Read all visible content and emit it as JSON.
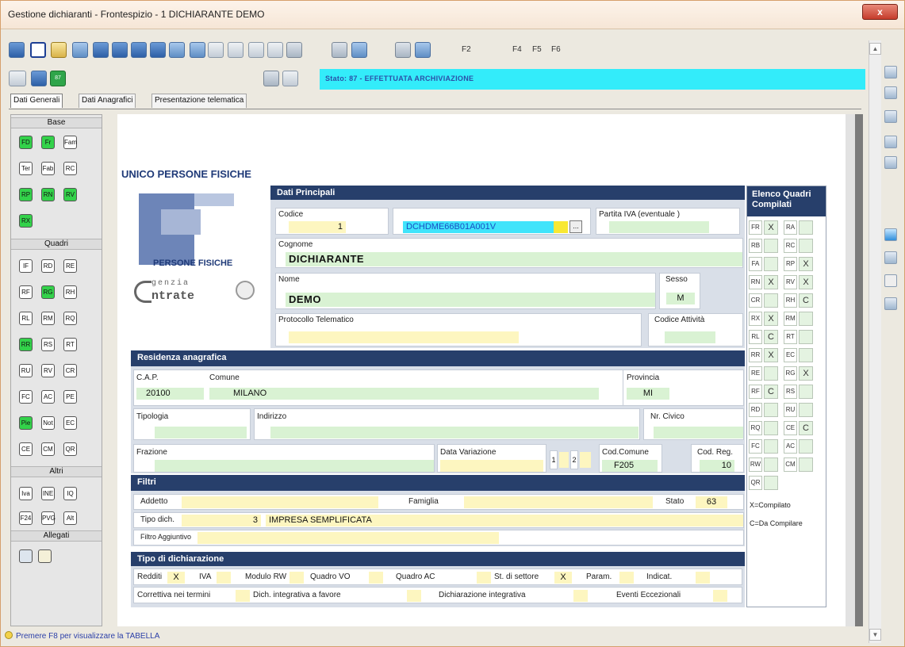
{
  "window": {
    "title": "Gestione dichiaranti - Frontespizio - 1 DICHIARANTE DEMO",
    "close_label": "x"
  },
  "toolbar": {
    "fkeys": [
      "F2",
      "F4",
      "F5",
      "F6"
    ],
    "small_badge": "87"
  },
  "status": {
    "text": "Stato: 87 - EFFETTUATA ARCHIVIAZIONE",
    "color": "#33ecfa"
  },
  "tabs": [
    "Dati Generali",
    "Dati Anagrafici",
    "Presentazione telematica"
  ],
  "left_panel": {
    "groups": [
      "Base",
      "Quadri",
      "Altri",
      "Allegati"
    ],
    "base": [
      {
        "code": "FD",
        "done": true
      },
      {
        "code": "Fr",
        "done": true
      },
      {
        "code": "Fam",
        "done": false
      },
      {
        "code": "Ter",
        "done": false
      },
      {
        "code": "Fab",
        "done": false
      },
      {
        "code": "RC",
        "done": false
      },
      {
        "code": "RP",
        "done": true
      },
      {
        "code": "RN",
        "done": true
      },
      {
        "code": "RV",
        "done": true
      },
      {
        "code": "RX",
        "done": true
      }
    ],
    "quadri": [
      {
        "code": "IF",
        "done": false
      },
      {
        "code": "RD",
        "done": false
      },
      {
        "code": "RE",
        "done": false
      },
      {
        "code": "RF",
        "done": false
      },
      {
        "code": "RG",
        "done": true
      },
      {
        "code": "RH",
        "done": false
      },
      {
        "code": "RL",
        "done": false
      },
      {
        "code": "RM",
        "done": false
      },
      {
        "code": "RQ",
        "done": false
      },
      {
        "code": "RR",
        "done": true
      },
      {
        "code": "RS",
        "done": false
      },
      {
        "code": "RT",
        "done": false
      },
      {
        "code": "RU",
        "done": false
      },
      {
        "code": "RV",
        "done": false
      },
      {
        "code": "CR",
        "done": false
      },
      {
        "code": "FC",
        "done": false
      },
      {
        "code": "AC",
        "done": false
      },
      {
        "code": "PE",
        "done": false
      },
      {
        "code": "Pie",
        "done": true
      },
      {
        "code": "Not",
        "done": false
      },
      {
        "code": "EC",
        "done": false
      },
      {
        "code": "CE",
        "done": false
      },
      {
        "code": "CM",
        "done": false
      },
      {
        "code": "QR",
        "done": false
      }
    ],
    "altri": [
      {
        "code": "Iva",
        "done": false
      },
      {
        "code": "INE",
        "done": false
      },
      {
        "code": "IQ",
        "done": false
      },
      {
        "code": "F24",
        "done": false
      },
      {
        "code": "PVG",
        "done": false
      },
      {
        "code": "Alt",
        "done": false
      }
    ]
  },
  "form": {
    "heading": "UNICO PERSONE FISICHE",
    "logo": {
      "line1": "PERSONE FISICHE",
      "line2a": "genzia",
      "line2b": "ntrate"
    },
    "dati_principali": {
      "header": "Dati Principali",
      "codice_label": "Codice",
      "codice_value": "1",
      "cf_value": "DCHDME66B01A001V",
      "cf_button": "...",
      "piva_label": "Partita IVA (eventuale )",
      "piva_value": "",
      "cognome_label": "Cognome",
      "cognome_value": "DICHIARANTE",
      "nome_label": "Nome",
      "nome_value": "DEMO",
      "sesso_label": "Sesso",
      "sesso_value": "M",
      "protocollo_label": "Protocollo Telematico",
      "protocollo_value": "",
      "codice_attivita_label": "Codice Attività",
      "codice_attivita_value": ""
    },
    "residenza": {
      "header": "Residenza anagrafica",
      "cap_label": "C.A.P.",
      "cap_value": "20100",
      "comune_label": "Comune",
      "comune_value": "MILANO",
      "provincia_label": "Provincia",
      "provincia_value": "MI",
      "tipologia_label": "Tipologia",
      "tipologia_value": "",
      "indirizzo_label": "Indirizzo",
      "indirizzo_value": "",
      "civico_label": "Nr. Civico",
      "civico_value": "",
      "frazione_label": "Frazione",
      "frazione_value": "",
      "data_variazione_label": "Data Variazione",
      "data_variazione_value": "",
      "dv_box1": "1",
      "dv_box2": "2",
      "cod_comune_label": "Cod.Comune",
      "cod_comune_value": "F205",
      "cod_reg_label": "Cod. Reg.",
      "cod_reg_value": "10"
    },
    "filtri": {
      "header": "Filtri",
      "addetto_label": "Addetto",
      "addetto_value": "",
      "famiglia_label": "Famiglia",
      "famiglia_value": "",
      "stato_label": "Stato",
      "stato_value": "63",
      "tipo_dich_label": "Tipo dich.",
      "tipo_dich_code": "3",
      "tipo_dich_value": "IMPRESA SEMPLIFICATA",
      "filtro_agg_label": "Filtro Aggiuntivo",
      "filtro_agg_value": ""
    },
    "tipo_dichiarazione": {
      "header": "Tipo di dichiarazione",
      "row1": [
        {
          "label": "Redditi",
          "value": "X"
        },
        {
          "label": "IVA",
          "value": ""
        },
        {
          "label": "Modulo RW",
          "value": ""
        },
        {
          "label": "Quadro VO",
          "value": ""
        },
        {
          "label": "Quadro AC",
          "value": ""
        },
        {
          "label": "St. di settore",
          "value": "X"
        },
        {
          "label": "Param.",
          "value": ""
        },
        {
          "label": "Indicat.",
          "value": ""
        }
      ],
      "row2": [
        {
          "label": "Correttiva nei termini",
          "value": ""
        },
        {
          "label": "Dich. integrativa a favore",
          "value": ""
        },
        {
          "label": "Dichiarazione integrativa",
          "value": ""
        },
        {
          "label": "Eventi Eccezionali",
          "value": ""
        }
      ]
    },
    "elenco_quadri": {
      "header": "Elenco Quadri Compilati",
      "rows": [
        [
          {
            "code": "FR",
            "v": "X"
          },
          {
            "code": "RA",
            "v": ""
          }
        ],
        [
          {
            "code": "RB",
            "v": ""
          },
          {
            "code": "RC",
            "v": ""
          }
        ],
        [
          {
            "code": "FA",
            "v": ""
          },
          {
            "code": "RP",
            "v": "X"
          }
        ],
        [
          {
            "code": "RN",
            "v": "X"
          },
          {
            "code": "RV",
            "v": "X"
          }
        ],
        [
          {
            "code": "CR",
            "v": ""
          },
          {
            "code": "RH",
            "v": "C"
          }
        ],
        [
          {
            "code": "RX",
            "v": "X"
          },
          {
            "code": "RM",
            "v": ""
          }
        ],
        [
          {
            "code": "RL",
            "v": "C"
          },
          {
            "code": "RT",
            "v": ""
          }
        ],
        [
          {
            "code": "RR",
            "v": "X"
          },
          {
            "code": "EC",
            "v": ""
          }
        ],
        [
          {
            "code": "RE",
            "v": ""
          },
          {
            "code": "RG",
            "v": "X"
          }
        ],
        [
          {
            "code": "RF",
            "v": "C"
          },
          {
            "code": "RS",
            "v": ""
          }
        ],
        [
          {
            "code": "RD",
            "v": ""
          },
          {
            "code": "RU",
            "v": ""
          }
        ],
        [
          {
            "code": "RQ",
            "v": ""
          },
          {
            "code": "CE",
            "v": "C"
          }
        ],
        [
          {
            "code": "FC",
            "v": ""
          },
          {
            "code": "AC",
            "v": ""
          }
        ],
        [
          {
            "code": "RW",
            "v": ""
          },
          {
            "code": "CM",
            "v": ""
          }
        ],
        [
          {
            "code": "QR",
            "v": ""
          }
        ]
      ],
      "legend_x": "X=Compilato",
      "legend_c": "C=Da Compilare"
    }
  },
  "hint": "Premere F8 per visualizzare la TABELLA"
}
